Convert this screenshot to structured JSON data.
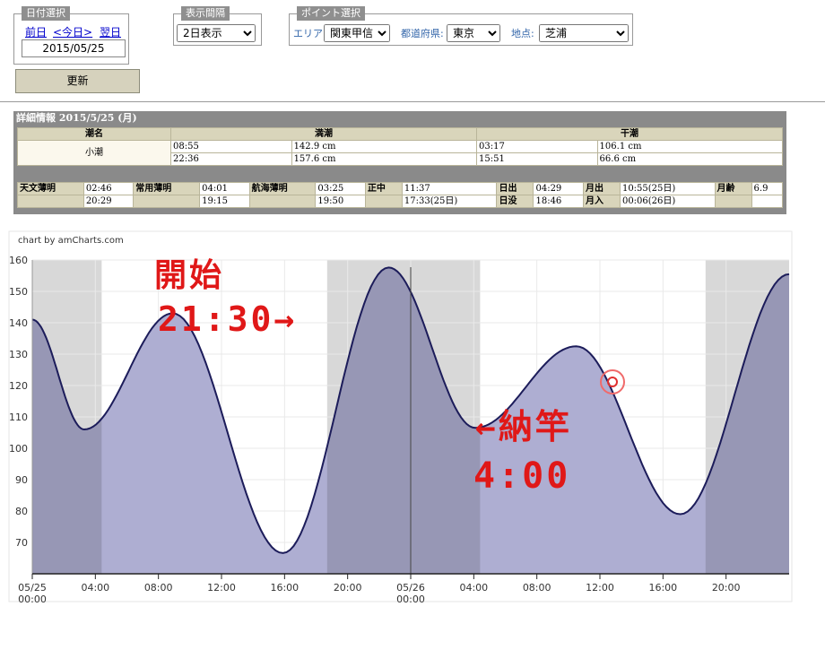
{
  "date_select": {
    "legend": "日付選択",
    "prev": "前日",
    "today": "<今日>",
    "next": "翌日",
    "date_value": "2015/05/25",
    "update_button": "更新"
  },
  "interval": {
    "legend": "表示間隔",
    "value": "2日表示"
  },
  "point_select": {
    "legend": "ポイント選択",
    "area_label": "エリア:",
    "area_value": "関東甲信",
    "pref_label": "都道府県:",
    "pref_value": "東京",
    "spot_label": "地点:",
    "spot_value": "芝浦"
  },
  "detail": {
    "title": "詳細情報 2015/5/25 (月)",
    "tide_headers": [
      "潮名",
      "満潮",
      "干潮"
    ],
    "tide_name": "小潮",
    "high_tides": [
      {
        "time": "08:55",
        "level": "142.9 cm"
      },
      {
        "time": "22:36",
        "level": "157.6 cm"
      }
    ],
    "low_tides": [
      {
        "time": "03:17",
        "level": "106.1 cm"
      },
      {
        "time": "15:51",
        "level": "66.6 cm"
      }
    ],
    "astro_row1": [
      {
        "label": "天文薄明",
        "value": "02:46"
      },
      {
        "label": "常用薄明",
        "value": "04:01"
      },
      {
        "label": "航海薄明",
        "value": "03:25"
      },
      {
        "label": "正中",
        "value": "11:37"
      },
      {
        "label": "日出",
        "value": "04:29"
      },
      {
        "label": "月出",
        "value": "10:55(25日)"
      },
      {
        "label": "月齢",
        "value": "6.9"
      }
    ],
    "astro_row2": [
      "20:29",
      "19:15",
      "19:50",
      "17:33(25日)",
      {
        "label": "日没",
        "value": "18:46"
      },
      {
        "label": "月入",
        "value": "00:06(26日)"
      }
    ]
  },
  "chart_credit": "chart by amCharts.com",
  "annotations": {
    "start_text": "開始",
    "start_time": "21:30→",
    "end_text": "←納竿",
    "end_time": "4:00"
  },
  "chart_data": {
    "type": "area",
    "y_ticks": [
      70,
      80,
      90,
      100,
      110,
      120,
      130,
      140,
      150,
      160
    ],
    "ylim": [
      60,
      160
    ],
    "x_range_hours": [
      0,
      48
    ],
    "x_ticks": [
      {
        "h": 0,
        "label": "05/25",
        "sub": "00:00"
      },
      {
        "h": 4,
        "label": "04:00"
      },
      {
        "h": 8,
        "label": "08:00"
      },
      {
        "h": 12,
        "label": "12:00"
      },
      {
        "h": 16,
        "label": "16:00"
      },
      {
        "h": 20,
        "label": "20:00"
      },
      {
        "h": 24,
        "label": "05/26",
        "sub": "00:00"
      },
      {
        "h": 28,
        "label": "04:00"
      },
      {
        "h": 32,
        "label": "08:00"
      },
      {
        "h": 36,
        "label": "12:00"
      },
      {
        "h": 40,
        "label": "16:00"
      },
      {
        "h": 44,
        "label": "20:00"
      }
    ],
    "series": [
      {
        "points": [
          [
            0,
            141
          ],
          [
            3.3,
            106
          ],
          [
            8.9,
            143
          ],
          [
            15.9,
            66.6
          ],
          [
            22.6,
            157.6
          ],
          [
            28.1,
            106.5
          ],
          [
            34.5,
            132.5
          ],
          [
            41.1,
            79
          ],
          [
            48,
            155.5
          ]
        ]
      }
    ],
    "night_bands": [
      [
        0,
        4.4
      ],
      [
        18.7,
        28.4
      ],
      [
        42.7,
        48
      ]
    ],
    "cursor_hour": 24,
    "colors": {
      "fill": "#aeaed2",
      "line": "#1c1c5a",
      "band": "#d8d8d8",
      "night_fill": "#9797b5"
    }
  }
}
